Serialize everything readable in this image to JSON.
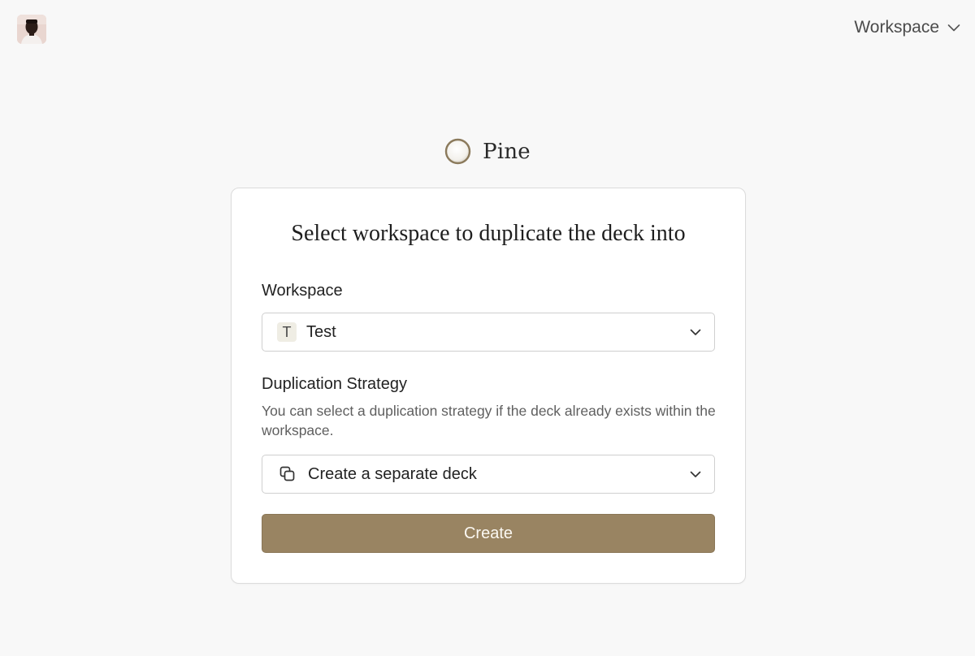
{
  "header": {
    "workspace_switcher_label": "Workspace"
  },
  "brand": {
    "name": "Pine"
  },
  "dialog": {
    "title": "Select workspace to duplicate the deck into",
    "workspace_field": {
      "label": "Workspace",
      "selected_badge": "T",
      "selected_value": "Test"
    },
    "strategy_field": {
      "label": "Duplication Strategy",
      "help": "You can select a duplication strategy if the deck already exists within the workspace.",
      "selected_value": "Create a separate deck"
    },
    "submit_label": "Create"
  },
  "colors": {
    "page_background": "#f8f8f8",
    "primary_button": "#998462",
    "brand_ring": "#8b7a5c"
  },
  "icons": {
    "avatar": "user-avatar",
    "workspace_chevron": "chevron-down-icon",
    "brand_logo": "pine-circle-logo",
    "strategy_icon": "copy-icon"
  }
}
